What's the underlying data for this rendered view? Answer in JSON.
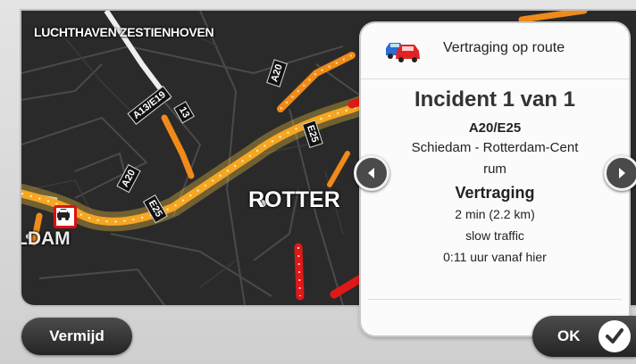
{
  "map": {
    "airport_label": "LUCHTHAVEN ZESTIENHOVEN",
    "city_label": "ROTTER",
    "town_label": "LDAM",
    "road_shields": [
      "A13/E19",
      "A20",
      "A20",
      "E25",
      "13",
      "A20"
    ],
    "route_color": "#f5a623",
    "jam_color": "#e01818",
    "slow_color": "#f08a1a"
  },
  "panel": {
    "icon": "traffic-cars-icon",
    "title": "Vertraging op route",
    "incident_count": "Incident 1 van 1",
    "road": "A20/E25",
    "segment_line1": "Schiedam - Rotterdam-Cent",
    "segment_line2": "rum",
    "delay_heading": "Vertraging",
    "delay_amount": "2 min (2.2 km)",
    "traffic_type": "slow traffic",
    "eta": "0:11 uur vanaf hier"
  },
  "navigation": {
    "prev_icon": "arrow-left-icon",
    "next_icon": "arrow-right-icon"
  },
  "buttons": {
    "avoid_label": "Vermijd",
    "ok_label": "OK"
  }
}
